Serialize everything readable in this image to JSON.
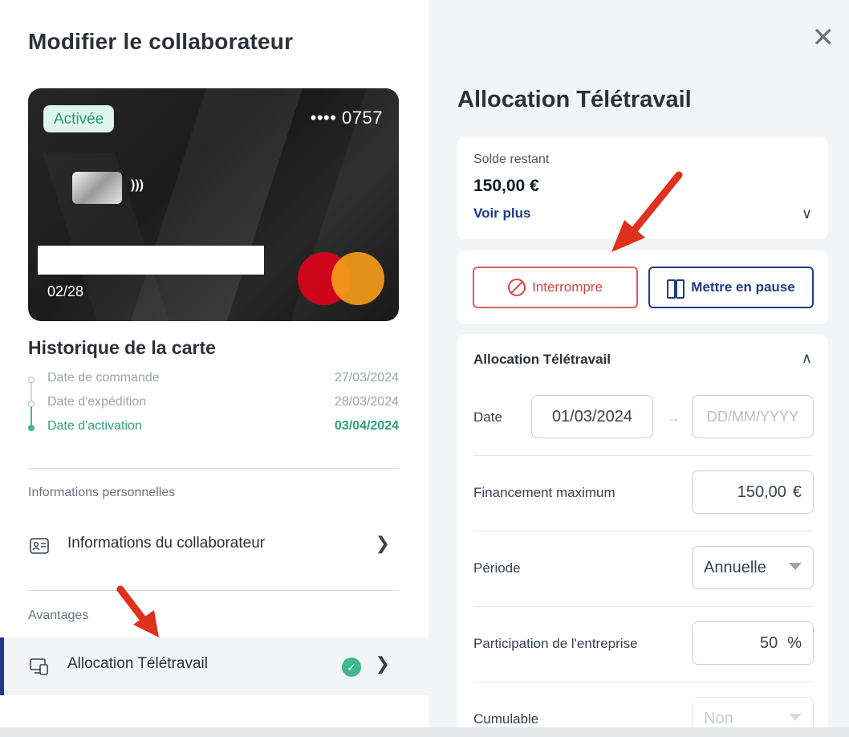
{
  "left_panel": {
    "title": "Modifier le collaborateur",
    "card": {
      "status_badge": "Activée",
      "number_masked": "•••• 0757",
      "expiry": "02/28",
      "brand": "mastercard"
    },
    "history": {
      "title": "Historique de la carte",
      "events": [
        {
          "label": "Date de commande",
          "date": "27/03/2024",
          "active": false
        },
        {
          "label": "Date d'expédition",
          "date": "28/03/2024",
          "active": false
        },
        {
          "label": "Date d'activation",
          "date": "03/04/2024",
          "active": true
        }
      ]
    },
    "personal_section": {
      "label": "Informations personnelles",
      "item_label": "Informations du collaborateur"
    },
    "benefits_section": {
      "label": "Avantages",
      "item_label": "Allocation Télétravail"
    }
  },
  "right_panel": {
    "title": "Allocation Télétravail",
    "balance": {
      "label": "Solde restant",
      "value": "150,00 €",
      "more_link": "Voir plus"
    },
    "actions": {
      "interrupt_label": "Interrompre",
      "pause_label": "Mettre en pause"
    },
    "form": {
      "header": "Allocation Télétravail",
      "date_label": "Date",
      "date_start": "01/03/2024",
      "date_end_placeholder": "DD/MM/YYYY",
      "max_funding_label": "Financement maximum",
      "max_funding_value": "150,00",
      "currency": "€",
      "period_label": "Période",
      "period_value": "Annuelle",
      "participation_label": "Participation de l'entreprise",
      "participation_value": "50",
      "percent": "%",
      "cumulable_label": "Cumulable",
      "cumulable_value": "Non"
    }
  },
  "colors": {
    "accent_navy": "#1e3a8a",
    "success_green": "#3fb98c",
    "danger_red": "#d64545",
    "annotation_red": "#e0301e"
  }
}
